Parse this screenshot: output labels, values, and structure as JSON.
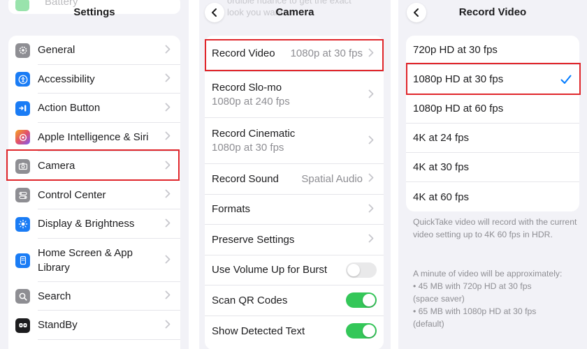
{
  "settings": {
    "title": "Settings",
    "top_item": "Battery",
    "items": [
      {
        "label": "General",
        "icon": "gear-icon",
        "color": "#8e8e93"
      },
      {
        "label": "Accessibility",
        "icon": "accessibility-icon",
        "color": "#1a7cf5"
      },
      {
        "label": "Action Button",
        "icon": "action-button-icon",
        "color": "#1a7cf5"
      },
      {
        "label": "Apple Intelligence & Siri",
        "icon": "siri-icon",
        "color": "#e2506b"
      },
      {
        "label": "Camera",
        "icon": "camera-icon",
        "color": "#8e8e93"
      },
      {
        "label": "Control Center",
        "icon": "control-center-icon",
        "color": "#8e8e93"
      },
      {
        "label": "Display & Brightness",
        "icon": "brightness-icon",
        "color": "#1a7cf5"
      },
      {
        "label": "Home Screen & App Library",
        "icon": "home-screen-icon",
        "color": "#1a7cf5"
      },
      {
        "label": "Search",
        "icon": "search-icon",
        "color": "#8e8e93"
      },
      {
        "label": "StandBy",
        "icon": "standby-icon",
        "color": "#1c1c1e"
      }
    ]
  },
  "camera": {
    "title": "Camera",
    "faded_text": "ordible nuance to get the exact look you want.",
    "items": [
      {
        "label": "Record Video",
        "value": "1080p at 30 fps"
      },
      {
        "label": "Record Slo-mo",
        "value": "1080p at 240 fps"
      },
      {
        "label": "Record Cinematic",
        "value": "1080p at 30 fps"
      },
      {
        "label": "Record Sound",
        "value": "Spatial Audio"
      },
      {
        "label": "Formats"
      },
      {
        "label": "Preserve Settings"
      },
      {
        "label": "Use Volume Up for Burst",
        "toggle": false
      },
      {
        "label": "Scan QR Codes",
        "toggle": true
      },
      {
        "label": "Show Detected Text",
        "toggle": true
      }
    ]
  },
  "record_video": {
    "title": "Record Video",
    "options": [
      "720p HD at 30 fps",
      "1080p HD at 30 fps",
      "1080p HD at 60 fps",
      "4K at 24 fps",
      "4K at 30 fps",
      "4K at 60 fps"
    ],
    "selected": "1080p HD at 30 fps",
    "note1": "QuickTake video will record with the current video setting up to 4K 60 fps in HDR.",
    "note2_lines": [
      "A minute of video will be approximately:",
      "• 45 MB with 720p HD at 30 fps",
      "(space saver)",
      "• 65 MB with 1080p HD at 30 fps",
      "(default)"
    ]
  },
  "colors": {
    "accent": "#007aff",
    "highlight": "#e0262b",
    "toggle_on": "#34c759"
  }
}
